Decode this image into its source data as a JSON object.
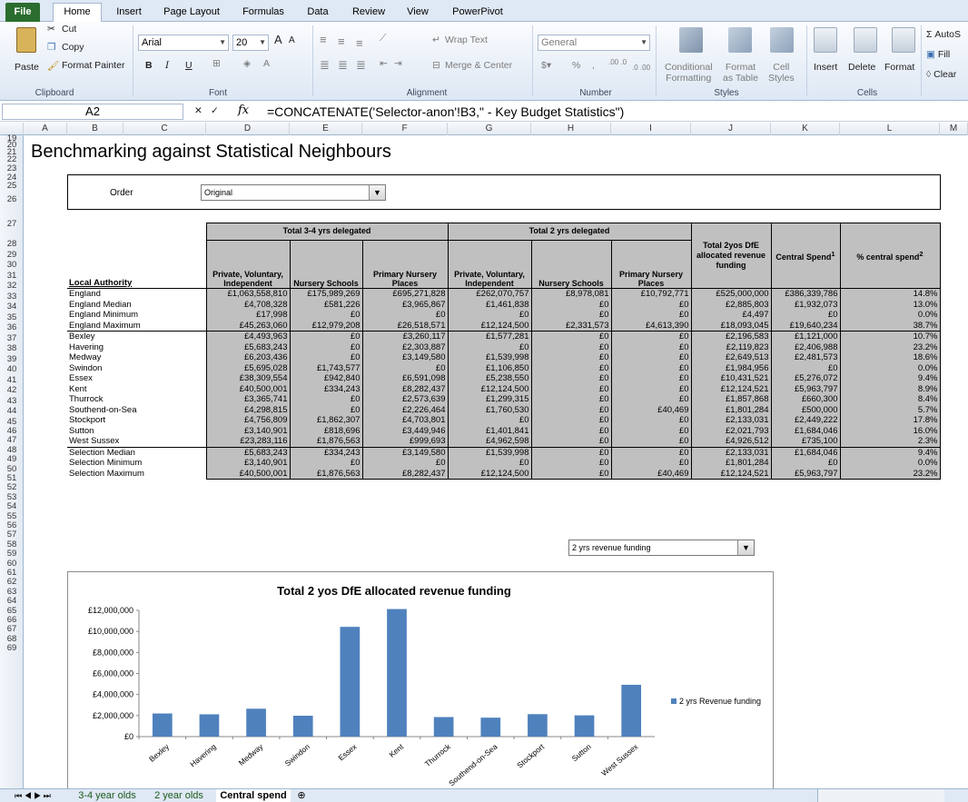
{
  "ribbon": {
    "tabs": [
      {
        "label": "File"
      },
      {
        "label": "Home"
      },
      {
        "label": "Insert"
      },
      {
        "label": "Page Layout"
      },
      {
        "label": "Formulas"
      },
      {
        "label": "Data"
      },
      {
        "label": "Review"
      },
      {
        "label": "View"
      },
      {
        "label": "PowerPivot"
      }
    ],
    "clipboard": {
      "paste": "Paste",
      "cut": "Cut",
      "copy": "Copy",
      "format_painter": "Format Painter",
      "group": "Clipboard"
    },
    "font": {
      "name": "Arial",
      "size": "20",
      "bold": "B",
      "italic": "I",
      "underline": "U",
      "grow": "A",
      "shrink": "A",
      "group": "Font"
    },
    "alignment": {
      "wrap": "Wrap Text",
      "merge": "Merge & Center",
      "group": "Alignment"
    },
    "number": {
      "format": "General",
      "pct": "%",
      "comma": ",",
      "group": "Number",
      "inc": ".00 .0",
      "dec": ".0 .00"
    },
    "styles": {
      "cond1": "Conditional",
      "cond2": "Formatting",
      "fmt1": "Format",
      "fmt2": "as Table",
      "cell1": "Cell",
      "cell2": "Styles",
      "group": "Styles"
    },
    "cells": {
      "insert": "Insert",
      "delete": "Delete",
      "format": "Format",
      "group": "Cells"
    },
    "editing": {
      "autosum": "Σ AutoS",
      "fill": "Fill",
      "clear": "Clear"
    }
  },
  "formula_bar": {
    "cell_ref": "A2",
    "fx": "fx",
    "formula": "=CONCATENATE('Selector-anon'!B3,\" - Key Budget Statistics\")"
  },
  "columns": [
    "A",
    "B",
    "C",
    "D",
    "E",
    "F",
    "G",
    "H",
    "I",
    "J",
    "K",
    "L",
    "M"
  ],
  "rows": [
    "19",
    "20",
    "21",
    "22",
    "23",
    "24",
    "25",
    "26",
    "27",
    "28",
    "29",
    "30",
    "31",
    "32",
    "33",
    "34",
    "35",
    "36",
    "37",
    "38",
    "39",
    "40",
    "41",
    "42",
    "43",
    "44",
    "45",
    "46",
    "47",
    "48",
    "49",
    "50",
    "51",
    "52",
    "53",
    "54",
    "55",
    "56",
    "57",
    "58",
    "59",
    "60",
    "61",
    "62",
    "63",
    "64",
    "65",
    "66",
    "67",
    "68",
    "69"
  ],
  "page_title": "Benchmarking against Statistical Neighbours",
  "order": {
    "label": "Order",
    "value": "Original"
  },
  "table": {
    "group1": "Total 3-4 yrs delegated",
    "group2": "Total  2 yrs delegated",
    "col_la": "Local Authority",
    "sub_pvi": "Private, Voluntary, Independent",
    "sub_ns": "Nursery Schools",
    "sub_pnp": "Primary Nursery Places",
    "col_dfe": "Total 2yos DfE allocated revenue funding",
    "col_central": "Central Spend",
    "col_central_sup": "1",
    "col_pct": "% central spend",
    "col_pct_sup": "2",
    "rows": [
      {
        "name": "England",
        "v": [
          "£1,063,558,810",
          "£175,989,269",
          "£695,271,828",
          "£262,070,757",
          "£8,978,081",
          "£10,792,771",
          "£525,000,000",
          "£386,339,786",
          "14.8%"
        ]
      },
      {
        "name": "England Median",
        "v": [
          "£4,708,328",
          "£581,226",
          "£3,965,867",
          "£1,461,838",
          "£0",
          "£0",
          "£2,885,803",
          "£1,932,073",
          "13.0%"
        ]
      },
      {
        "name": "England Minimum",
        "v": [
          "£17,998",
          "£0",
          "£0",
          "£0",
          "£0",
          "£0",
          "£4,497",
          "£0",
          "0.0%"
        ]
      },
      {
        "name": "England Maximum",
        "v": [
          "£45,263,060",
          "£12,979,208",
          "£26,518,571",
          "£12,124,500",
          "£2,331,573",
          "£4,613,390",
          "£18,093,045",
          "£19,640,234",
          "38.7%"
        ]
      },
      {
        "name": "Bexley",
        "v": [
          "£4,493,963",
          "£0",
          "£3,260,117",
          "£1,577,281",
          "£0",
          "£0",
          "£2,196,583",
          "£1,121,000",
          "10.7%"
        ]
      },
      {
        "name": "Havering",
        "v": [
          "£5,683,243",
          "£0",
          "£2,303,887",
          "£0",
          "£0",
          "£0",
          "£2,119,823",
          "£2,406,988",
          "23.2%"
        ]
      },
      {
        "name": "Medway",
        "v": [
          "£6,203,436",
          "£0",
          "£3,149,580",
          "£1,539,998",
          "£0",
          "£0",
          "£2,649,513",
          "£2,481,573",
          "18.6%"
        ]
      },
      {
        "name": "Swindon",
        "v": [
          "£5,695,028",
          "£1,743,577",
          "£0",
          "£1,106,850",
          "£0",
          "£0",
          "£1,984,956",
          "£0",
          "0.0%"
        ]
      },
      {
        "name": "Essex",
        "v": [
          "£38,309,554",
          "£942,840",
          "£6,591,098",
          "£5,238,550",
          "£0",
          "£0",
          "£10,431,521",
          "£5,276,072",
          "9.4%"
        ]
      },
      {
        "name": "Kent",
        "v": [
          "£40,500,001",
          "£334,243",
          "£8,282,437",
          "£12,124,500",
          "£0",
          "£0",
          "£12,124,521",
          "£5,963,797",
          "8.9%"
        ]
      },
      {
        "name": "Thurrock",
        "v": [
          "£3,365,741",
          "£0",
          "£2,573,639",
          "£1,299,315",
          "£0",
          "£0",
          "£1,857,868",
          "£660,300",
          "8.4%"
        ]
      },
      {
        "name": "Southend-on-Sea",
        "v": [
          "£4,298,815",
          "£0",
          "£2,226,464",
          "£1,760,530",
          "£0",
          "£40,469",
          "£1,801,284",
          "£500,000",
          "5.7%"
        ]
      },
      {
        "name": "Stockport",
        "v": [
          "£4,756,809",
          "£1,862,307",
          "£4,703,801",
          "£0",
          "£0",
          "£0",
          "£2,133,031",
          "£2,449,222",
          "17.8%"
        ]
      },
      {
        "name": "Sutton",
        "v": [
          "£3,140,901",
          "£818,696",
          "£3,449,946",
          "£1,401,841",
          "£0",
          "£0",
          "£2,021,793",
          "£1,684,046",
          "16.0%"
        ]
      },
      {
        "name": "West Sussex",
        "v": [
          "£23,283,116",
          "£1,876,563",
          "£999,693",
          "£4,962,598",
          "£0",
          "£0",
          "£4,926,512",
          "£735,100",
          "2.3%"
        ]
      },
      {
        "name": "Selection Median",
        "v": [
          "£5,683,243",
          "£334,243",
          "£3,149,580",
          "£1,539,998",
          "£0",
          "£0",
          "£2,133,031",
          "£1,684,046",
          "9.4%"
        ]
      },
      {
        "name": "Selection Minimum",
        "v": [
          "£3,140,901",
          "£0",
          "£0",
          "£0",
          "£0",
          "£0",
          "£1,801,284",
          "£0",
          "0.0%"
        ]
      },
      {
        "name": "Selection Maximum",
        "v": [
          "£40,500,001",
          "£1,876,563",
          "£8,282,437",
          "£12,124,500",
          "£0",
          "£40,469",
          "£12,124,521",
          "£5,963,797",
          "23.2%"
        ]
      }
    ]
  },
  "chart_selector": {
    "value": "2 yrs revenue funding"
  },
  "chart_data": {
    "type": "bar",
    "title": "Total 2 yos DfE allocated revenue funding",
    "categories": [
      "Bexley",
      "Havering",
      "Medway",
      "Swindon",
      "Essex",
      "Kent",
      "Thurrock",
      "Southend-on-Sea",
      "Stockport",
      "Sutton",
      "West Sussex"
    ],
    "series": [
      {
        "name": "2 yrs Revenue funding",
        "values": [
          2196583,
          2119823,
          2649513,
          1984956,
          10431521,
          12124521,
          1857868,
          1801284,
          2133031,
          2021793,
          4926512
        ]
      }
    ],
    "y_ticks": [
      "£0",
      "£2,000,000",
      "£4,000,000",
      "£6,000,000",
      "£8,000,000",
      "£10,000,000",
      "£12,000,000"
    ],
    "ylim": [
      0,
      12000000
    ],
    "legend_position": "right",
    "bar_color": "#4f81bd"
  },
  "sheet_tabs": [
    {
      "label": "3-4 year olds"
    },
    {
      "label": "2 year olds"
    },
    {
      "label": "Central spend"
    }
  ]
}
